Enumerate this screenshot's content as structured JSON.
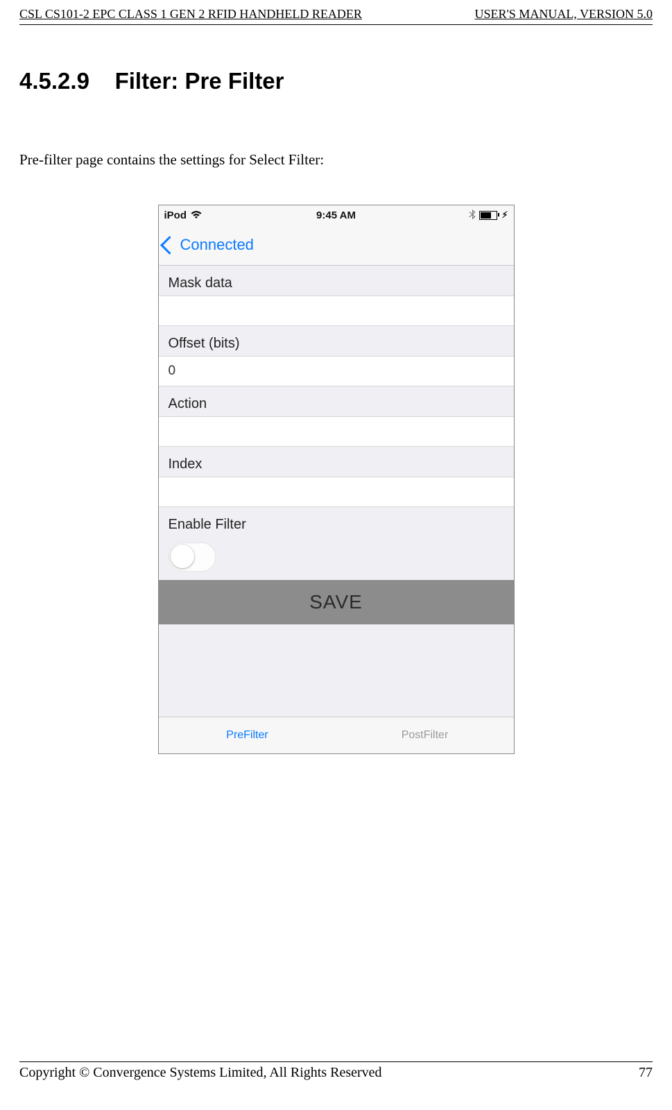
{
  "doc": {
    "header_left": "CSL CS101-2 EPC CLASS 1 GEN 2 RFID HANDHELD READER",
    "header_right": "USER'S  MANUAL,   VERSION  5.0",
    "section_number": "4.5.2.9",
    "section_title": "Filter: Pre Filter",
    "body": "Pre-filter page contains the settings for Select Filter:",
    "footer_left": "Copyright © Convergence Systems Limited, All Rights Reserved",
    "footer_right": "77"
  },
  "phone": {
    "status": {
      "carrier": "iPod",
      "time": "9:45 AM"
    },
    "nav": {
      "back_label": "Connected"
    },
    "fields": {
      "mask_label": "Mask data",
      "mask_value": "",
      "offset_label": "Offset (bits)",
      "offset_value": "0",
      "action_label": "Action",
      "action_value": "",
      "index_label": "Index",
      "index_value": "",
      "enable_label": "Enable Filter"
    },
    "save_label": "SAVE",
    "tabs": {
      "pre": "PreFilter",
      "post": "PostFilter"
    }
  }
}
